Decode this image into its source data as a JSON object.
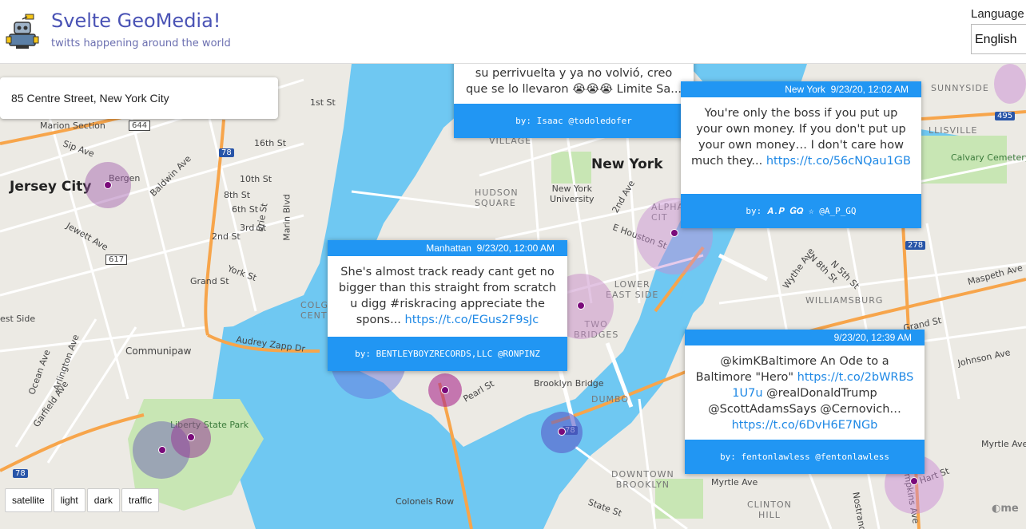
{
  "header": {
    "title": "Svelte GeoMedia!",
    "subtitle": "twitts happening around the world",
    "language_label": "Language",
    "language_selected": "English"
  },
  "search": {
    "value": "85 Centre Street, New York City"
  },
  "map_labels": {
    "new_york": "New York",
    "jersey_city": "Jersey City",
    "marion_section": "Marion Section",
    "bergen": "Bergen",
    "sip_ave": "Sip Ave",
    "baldwin_ave": "Baldwin Ave",
    "jewett_ave": "Jewett Ave",
    "grand_st": "Grand St",
    "york_st": "York St",
    "st_16th": "16th St",
    "st_10th": "10th St",
    "st_8th": "8th St",
    "st_6th": "6th St",
    "st_5th": "5th St",
    "st_3rd": "3rd St",
    "st_2nd": "2nd St",
    "st_1st": "1st St",
    "erie_st": "Erie St",
    "marin_blvd": "Marin Blvd",
    "west_side": "est Side",
    "ocean_ave": "Ocean Ave",
    "arlington_ave": "Arlington Ave",
    "garfield_ave": "Garfield Ave",
    "communipaw": "Communipaw",
    "audrey_zapp": "Audrey Zapp Dr",
    "liberty_state_park": "Liberty State Park",
    "colonels_row": "Colonels Row",
    "village": "VILLAGE",
    "hudson_square": "HUDSON\nSQUARE",
    "nyu": "New York\nUniversity",
    "alphabet_city": "ALPHA\nCIT",
    "e_houston": "E Houston St",
    "lower_east_side": "LOWER\nEAST SIDE",
    "two_bridges": "TWO\nBRIDGES",
    "colgate": "COLG\nCENTE",
    "brooklyn_bridge": "Brooklyn Bridge",
    "pearl_st": "Pearl St",
    "dumbo": "DUMBO",
    "downtown_brooklyn": "DOWNTOWN\nBROOKLYN",
    "clinton_hill": "CLINTON\nHILL",
    "myrtle_ave": "Myrtle Ave",
    "myrtle_ave_2": "Myrtle Ave",
    "state_st": "State St",
    "sunnyside": "SUNNYSIDE",
    "llisville": "LLISVILLE",
    "calvary": "Calvary Cemetery",
    "williamsburg": "WILLIAMSBURG",
    "grand_st_bk": "Grand St",
    "johnson_ave": "Johnson Ave",
    "maspeth_ave": "Maspeth Ave",
    "wythe_ave": "Wythe Ave",
    "n_8th": "N 8th St",
    "n_5th": "N 5th St",
    "ave_2nd": "2nd Ave",
    "hart_st": "Hart St",
    "nostrand": "Nostrand",
    "tompkins": "ompkins Ave",
    "shield_644": "644",
    "shield_617": "617",
    "shield_78a": "78",
    "shield_78b": "78",
    "shield_78c": "78",
    "shield_278": "278",
    "shield_495": "495"
  },
  "tweets": [
    {
      "location": "",
      "time": "",
      "text": "su perrivuelta y ya no volvió, creo que se lo llevaron 😭😭😭 Limite Sa...",
      "link": "",
      "author": "by: Isaac @todoledofer"
    },
    {
      "location": "New York",
      "time": "9/23/20, 12:02 AM",
      "text": "You're only the boss if you put up your own money. If you don't put up your own money… I don't care how much they...",
      "link": "https://t.co/56cNQau1GB",
      "author": "by: 𝑨.𝑷 𝑮𝑸 ☆ @A_P_GQ"
    },
    {
      "location": "Manhattan",
      "time": "9/23/20, 12:00 AM",
      "text": "She's almost track ready cant get no bigger than this straight from scratch u digg #riskracing appreciate the spons...",
      "link": "https://t.co/EGus2F9sJc",
      "author": "by: BENTLEYBOYZRECORDS,LLC @RONPINZ"
    },
    {
      "location": "",
      "time": "9/23/20, 12:39 AM",
      "text": "@kimKBaltimore An Ode to a Baltimore \"Hero\" ",
      "link": "https://t.co/2bWRBS1U7u",
      "text2": " @realDonaldTrump @ScottAdamsSays @Cernovich…",
      "link2": "https://t.co/6DvH6E7NGb",
      "author": "by: fentonlawless @fentonlawless"
    }
  ],
  "map_styles": [
    "satellite",
    "light",
    "dark",
    "traffic"
  ],
  "attribution": "me",
  "colors": {
    "brand": "#4a53b5",
    "card_accent": "#2196f3",
    "water": "#6fc8f2",
    "park": "#c8e6b4",
    "highway": "#f7a54b",
    "marker": "#7a0a7a"
  }
}
